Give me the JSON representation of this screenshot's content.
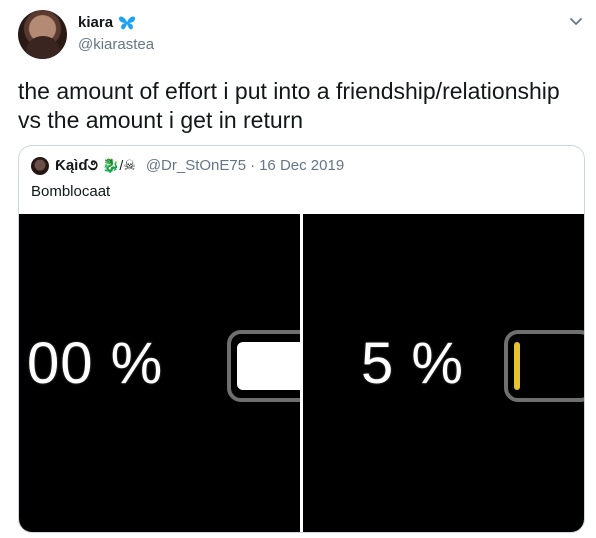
{
  "author": {
    "display_name": "kiara",
    "handle": "@kiarastea",
    "badge_icon": "butterfly-icon"
  },
  "tweet": {
    "text": "the amount of effort i put into a friendship/relationship\nvs the amount i get in return"
  },
  "quoted_tweet": {
    "display_name": "Ƙąìɗ૭",
    "name_emoji": "🐉/☠",
    "handle": "@Dr_StOnE75",
    "separator": "·",
    "date": "16 Dec 2019",
    "text": "Bomblocaat",
    "media": {
      "left_panel": {
        "percent_text": "00 %",
        "battery_level": 1.0,
        "fill_color": "#ffffff"
      },
      "right_panel": {
        "percent_text": "5 %",
        "battery_level": 0.05,
        "fill_color": "#e6c233"
      }
    }
  },
  "colors": {
    "text_primary": "#14171a",
    "text_secondary": "#657786",
    "border": "#ccd6dd",
    "butterfly": "#1da1f2"
  }
}
